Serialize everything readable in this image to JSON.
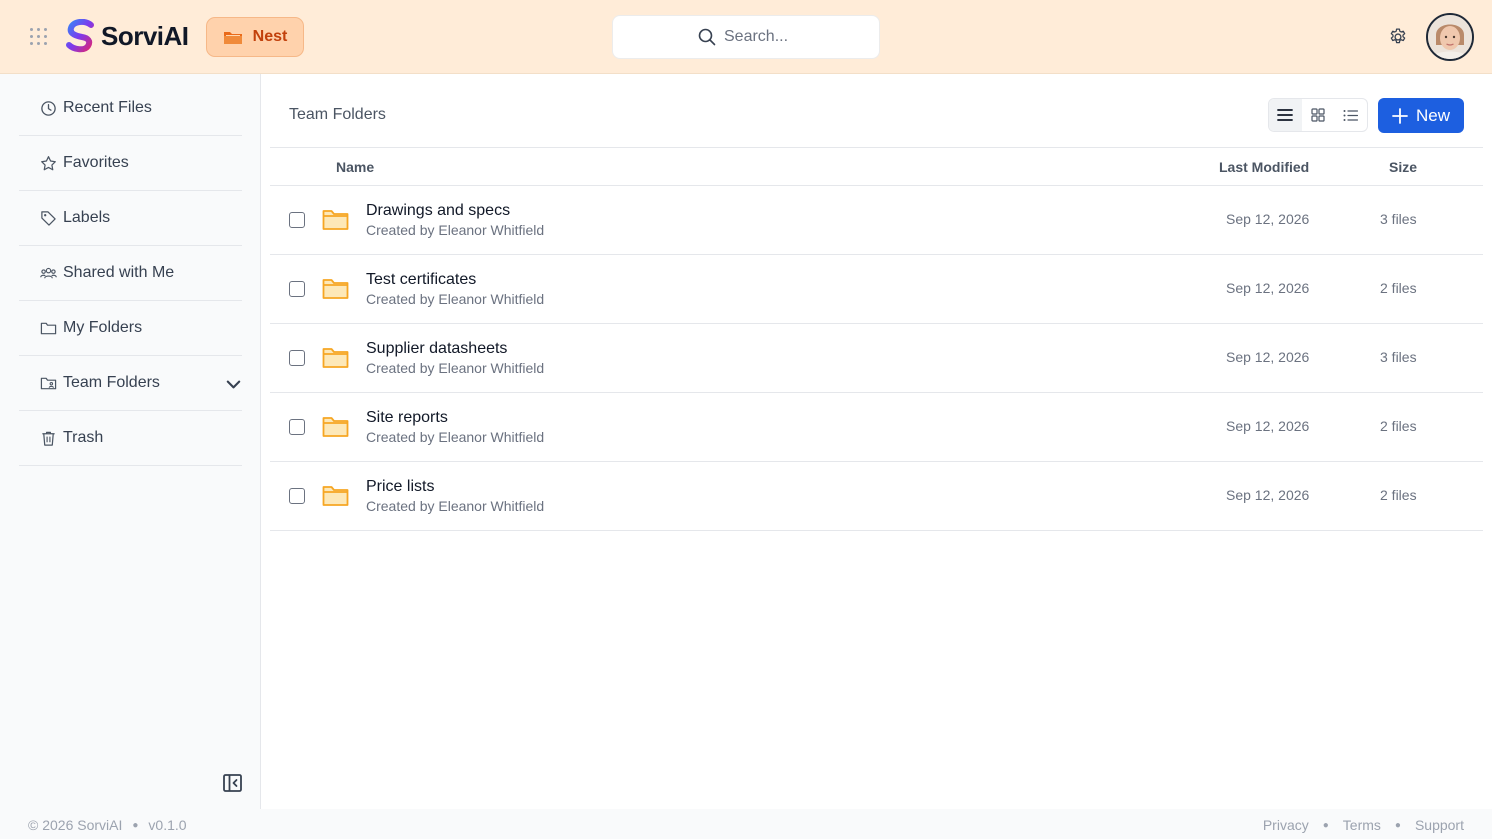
{
  "header": {
    "app_name": "SorviAI",
    "nest_label": "Nest",
    "search": {
      "placeholder": "Search..."
    }
  },
  "sidebar": {
    "items": [
      {
        "label": "Recent Files",
        "icon": "clock-icon"
      },
      {
        "label": "Favorites",
        "icon": "star-icon"
      },
      {
        "label": "Labels",
        "icon": "tag-icon"
      },
      {
        "label": "Shared with Me",
        "icon": "users-icon"
      },
      {
        "label": "My Folders",
        "icon": "folder-icon"
      },
      {
        "label": "Team Folders",
        "icon": "folder-user-icon",
        "expandable": true
      },
      {
        "label": "Trash",
        "icon": "trash-icon"
      }
    ]
  },
  "main": {
    "title": "Team Folders",
    "new_label": "New",
    "columns": {
      "name": "Name",
      "modified": "Last Modified",
      "size": "Size"
    },
    "rows": [
      {
        "name": "Drawings and specs",
        "creator": "Created by Eleanor Whitfield",
        "modified": "Sep 12, 2026",
        "size": "3 files"
      },
      {
        "name": "Test certificates",
        "creator": "Created by Eleanor Whitfield",
        "modified": "Sep 12, 2026",
        "size": "2 files"
      },
      {
        "name": "Supplier datasheets",
        "creator": "Created by Eleanor Whitfield",
        "modified": "Sep 12, 2026",
        "size": "3 files"
      },
      {
        "name": "Site reports",
        "creator": "Created by Eleanor Whitfield",
        "modified": "Sep 12, 2026",
        "size": "2 files"
      },
      {
        "name": "Price lists",
        "creator": "Created by Eleanor Whitfield",
        "modified": "Sep 12, 2026",
        "size": "2 files"
      }
    ]
  },
  "footer": {
    "copyright": "© 2026 SorviAI",
    "version": "v0.1.0",
    "links": [
      "Privacy",
      "Terms",
      "Support"
    ]
  },
  "colors": {
    "header_bg": "#ffecd8",
    "accent": "#1d5fe0",
    "nest_text": "#c2410c",
    "folder": "#f6a623"
  }
}
